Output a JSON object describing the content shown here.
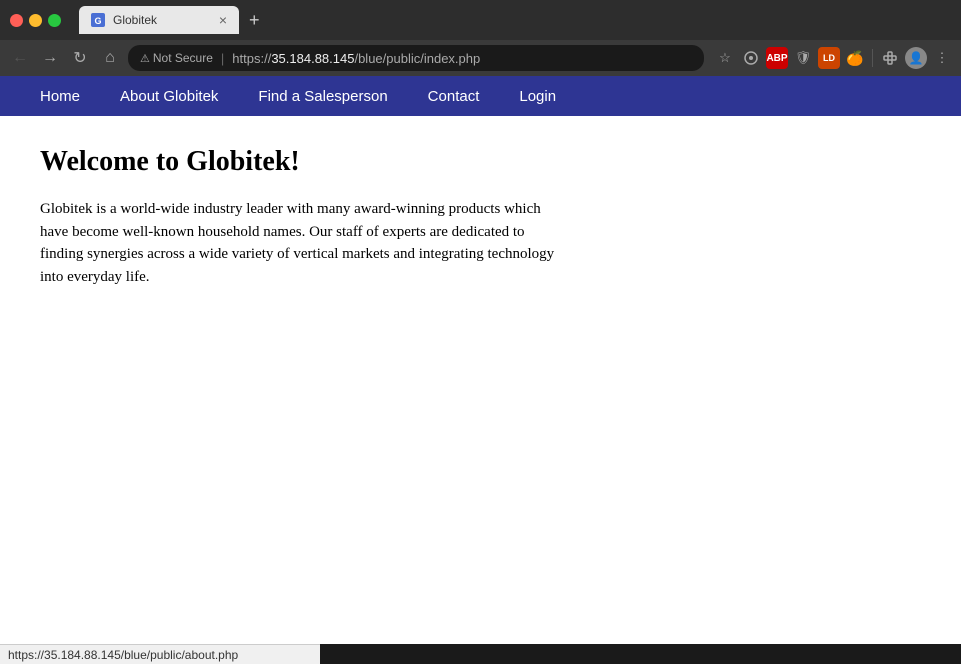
{
  "browser": {
    "tab": {
      "title": "Globitek",
      "favicon_label": "G"
    },
    "new_tab_label": "+",
    "close_tab_label": "×"
  },
  "address_bar": {
    "security_label": "Not Secure",
    "url_prefix": "https://",
    "url_host": "35.184.88.145",
    "url_path": "/blue/public/index.php",
    "url_full": "https://35.184.88.145/blue/public/index.php"
  },
  "toolbar": {
    "back_icon": "←",
    "forward_icon": "→",
    "reload_icon": "↻",
    "home_icon": "⌂",
    "bookmark_icon": "☆",
    "extensions_icon": "🧩",
    "abp_label": "ABP",
    "ld_label": "LD",
    "more_icon": "⋮"
  },
  "navbar": {
    "items": [
      {
        "label": "Home",
        "href": "#"
      },
      {
        "label": "About Globitek",
        "href": "#"
      },
      {
        "label": "Find a Salesperson",
        "href": "#"
      },
      {
        "label": "Contact",
        "href": "#"
      },
      {
        "label": "Login",
        "href": "#"
      }
    ]
  },
  "page": {
    "title": "Welcome to Globitek!",
    "body": "Globitek is a world-wide industry leader with many award-winning products which have become well-known household names. Our staff of experts are dedicated to finding synergies across a wide variety of vertical markets and integrating technology into everyday life."
  },
  "status_bar": {
    "url": "https://35.184.88.145/blue/public/about.php"
  }
}
